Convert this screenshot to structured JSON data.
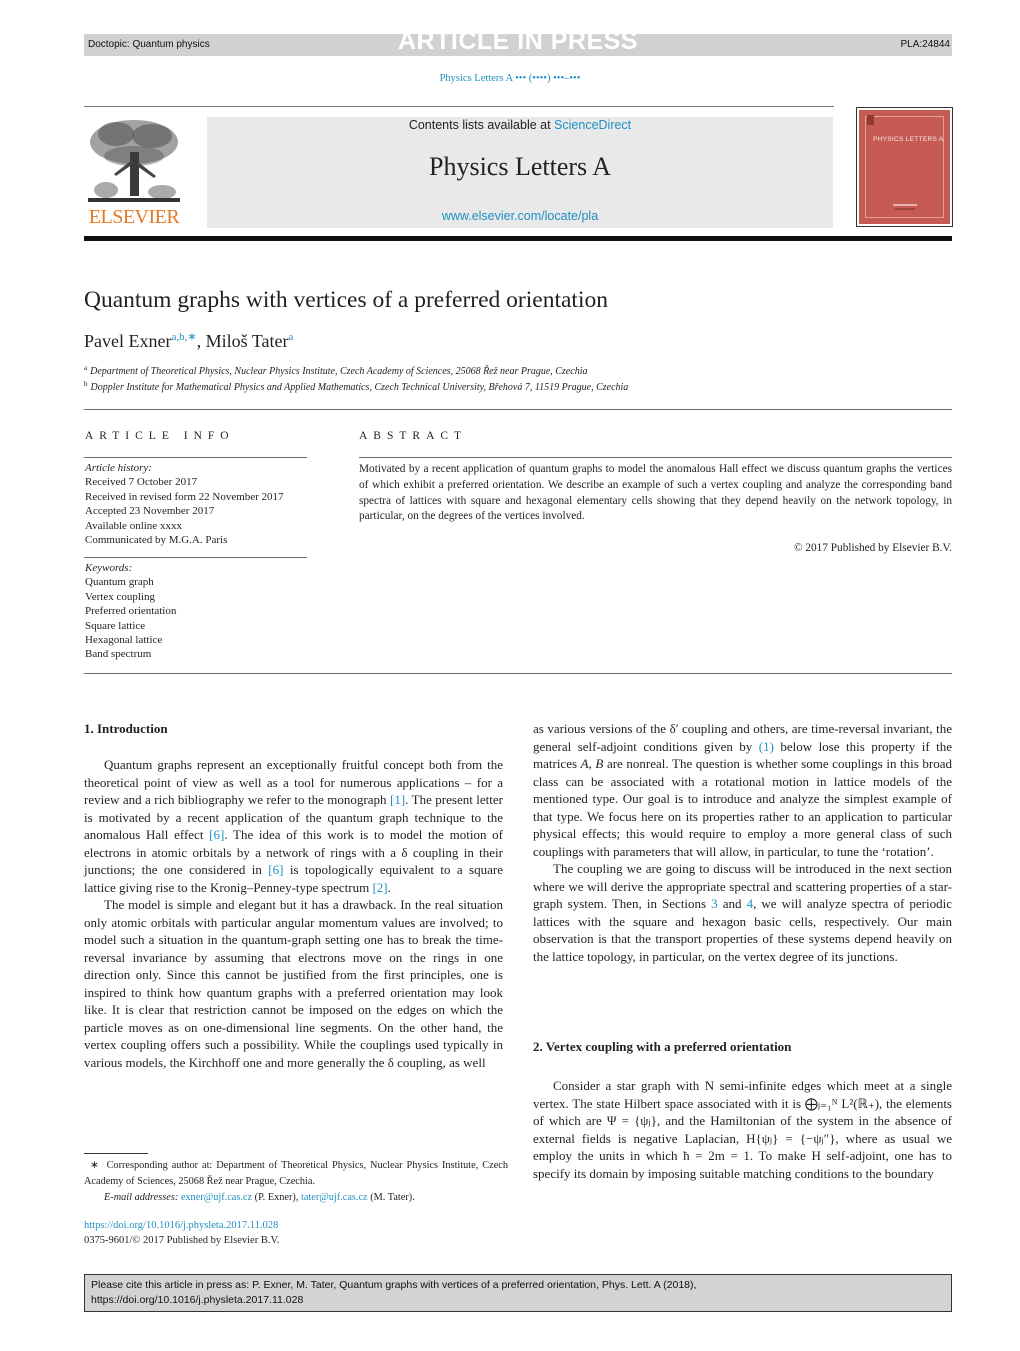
{
  "header": {
    "doctopic": "Doctopic: Quantum physics",
    "banner": "ARTICLE IN PRESS",
    "article_code": "PLA:24844",
    "journal_ref": "Physics Letters A ••• (••••) •••–•••"
  },
  "masthead": {
    "contents_prefix": "Contents lists available at ",
    "contents_link": "ScienceDirect",
    "journal_title": "Physics Letters A",
    "journal_url": "www.elsevier.com/locate/pla",
    "publisher_logo_text": "ELSEVIER",
    "cover_title": "PHYSICS LETTERS A"
  },
  "article": {
    "title": "Quantum graphs with vertices of a preferred orientation",
    "authors": [
      {
        "name": "Pavel Exner",
        "marks": "a,b,∗"
      },
      {
        "name": "Miloš Tater",
        "marks": "a"
      }
    ],
    "author_separator": ", ",
    "affiliations": [
      {
        "mark": "a",
        "text": "Department of Theoretical Physics, Nuclear Physics Institute, Czech Academy of Sciences, 25068 Řež near Prague, Czechia"
      },
      {
        "mark": "b",
        "text": "Doppler Institute for Mathematical Physics and Applied Mathematics, Czech Technical University, Břehová 7, 11519 Prague, Czechia"
      }
    ]
  },
  "article_info": {
    "heading": "ARTICLE INFO",
    "history_label": "Article history:",
    "history": [
      "Received 7 October 2017",
      "Received in revised form 22 November 2017",
      "Accepted 23 November 2017",
      "Available online xxxx",
      "Communicated by M.G.A. Paris"
    ],
    "keywords_label": "Keywords:",
    "keywords": [
      "Quantum graph",
      "Vertex coupling",
      "Preferred orientation",
      "Square lattice",
      "Hexagonal lattice",
      "Band spectrum"
    ]
  },
  "abstract": {
    "heading": "ABSTRACT",
    "text": "Motivated by a recent application of quantum graphs to model the anomalous Hall effect we discuss quantum graphs the vertices of which exhibit a preferred orientation. We describe an example of such a vertex coupling and analyze the corresponding band spectra of lattices with square and hexagonal elementary cells showing that they depend heavily on the network topology, in particular, on the degrees of the vertices involved.",
    "copyright": "© 2017 Published by Elsevier B.V."
  },
  "body": {
    "sec1_heading": "1.  Introduction",
    "p1": {
      "t1": "Quantum graphs represent an exceptionally fruitful concept both from the theoretical point of view as well as a tool for numerous applications – for a review and a rich bibliography we refer to the monograph ",
      "r1": "[1]",
      "t2": ". The present letter is motivated by a recent application of the quantum graph technique to the anomalous Hall effect ",
      "r2": "[6]",
      "t3": ". The idea of this work is to model the motion of electrons in atomic orbitals by a network of rings with a δ coupling in their junctions; the one considered in ",
      "r3": "[6]",
      "t4": " is topologically equivalent to a square lattice giving rise to the Kronig–Penney-type spectrum ",
      "r4": "[2]",
      "t5": "."
    },
    "p2": "The model is simple and elegant but it has a drawback. In the real situation only atomic orbitals with particular angular momentum values are involved; to model such a situation in the quantum-graph setting one has to break the time-reversal invariance by assuming that electrons move on the rings in one direction only. Since this cannot be justified from the first principles, one is inspired to think how quantum graphs with a preferred orientation may look like. It is clear that restriction cannot be imposed on the edges on which the particle moves as on one-dimensional line segments. On the other hand, the vertex coupling offers such a possibility. While the couplings used typically in various models, the Kirchhoff one and more generally the δ coupling, as well",
    "p3": {
      "t1": "as various versions of the δ′ coupling and others, are time-reversal invariant, the general self-adjoint conditions given by ",
      "r1": "(1)",
      "t2": " below lose this property if the matrices ",
      "m1": "A",
      "t3": ", ",
      "m2": "B",
      "t4": " are nonreal. The question is whether some couplings in this broad class can be associated with a rotational motion in lattice models of the mentioned type. Our goal is to introduce and analyze the simplest example of that type. We focus here on its properties rather to an application to particular physical effects; this would require to employ a more general class of such couplings with parameters that will allow, in particular, to tune the ‘rotation’."
    },
    "p4": {
      "t1": "The coupling we are going to discuss will be introduced in the next section where we will derive the appropriate spectral and scattering properties of a star-graph system. Then, in Sections ",
      "r1": "3",
      "t2": " and ",
      "r2": "4",
      "t3": ", we will analyze spectra of periodic lattices with the square and hexagon basic cells, respectively. Our main observation is that the transport properties of these systems depend heavily on the lattice topology, in particular, on the vertex degree of its junctions."
    },
    "sec2_heading": "2.  Vertex coupling with a preferred orientation",
    "p5": "Consider a star graph with N semi-infinite edges which meet at a single vertex. The state Hilbert space associated with it is ⨁ⱼ₌₁ᴺ L²(ℝ₊), the elements of which are Ψ = {ψⱼ}, and the Hamiltonian of the system in the absence of external fields is negative Laplacian, H{ψⱼ} = {−ψⱼ″}, where as usual we employ the units in which ħ = 2m = 1. To make H self-adjoint, one has to specify its domain by imposing suitable matching conditions to the boundary"
  },
  "footnotes": {
    "corresponding_mark": "∗",
    "corresponding_text": "Corresponding author at: Department of Theoretical Physics, Nuclear Physics Institute, Czech Academy of Sciences, 25068 Řež near Prague, Czechia.",
    "email_label": "E-mail addresses: ",
    "email1": "exner@ujf.cas.cz",
    "email1_owner": " (P. Exner), ",
    "email2": "tater@ujf.cas.cz",
    "email2_owner": " (M. Tater)."
  },
  "doi": {
    "link": "https://doi.org/10.1016/j.physleta.2017.11.028",
    "issn_line": "0375-9601/© 2017 Published by Elsevier B.V."
  },
  "cite_box": {
    "line1": "Please cite this article in press as: P. Exner, M. Tater, Quantum graphs with vertices of a preferred orientation, Phys. Lett. A (2018),",
    "line2": "https://doi.org/10.1016/j.physleta.2017.11.028"
  }
}
